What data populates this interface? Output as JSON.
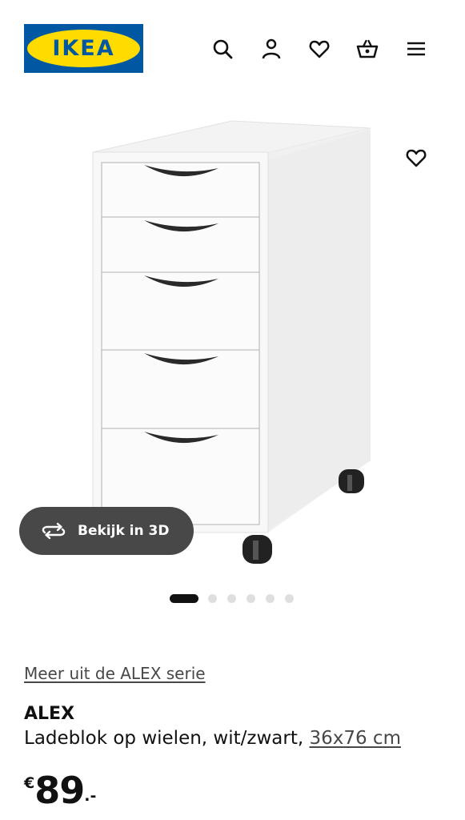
{
  "header": {
    "logo_text": "IKEA",
    "icons": [
      "search-icon",
      "user-icon",
      "heart-icon",
      "basket-icon",
      "menu-icon"
    ]
  },
  "gallery": {
    "favorite_icon": "heart-icon",
    "view_3d_label": "Bekijk in 3D",
    "dots_total": 6,
    "dots_active_index": 0
  },
  "product": {
    "series_link": "Meer uit de ALEX serie",
    "name": "ALEX",
    "description": "Ladeblok op wielen, wit/zwart,",
    "size_link": "36x76 cm",
    "price": {
      "currency": "€",
      "integer": "89",
      "decimal": ".-"
    }
  },
  "colors": {
    "ikea_blue": "#0058a3",
    "ikea_yellow": "#ffdb00",
    "pill_bg": "#484848",
    "dot_active": "#111111",
    "dot_inactive": "#dfdfdf"
  }
}
